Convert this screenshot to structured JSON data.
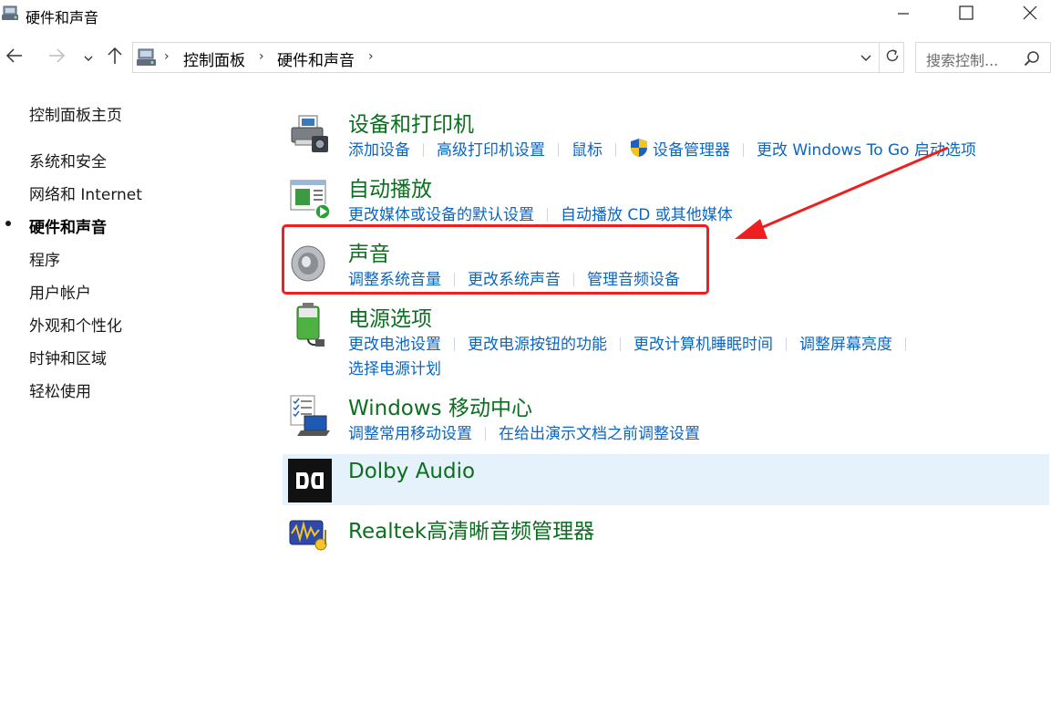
{
  "window": {
    "title": "硬件和声音",
    "icon": "control-panel-icon",
    "buttons": [
      "minimize-icon",
      "maximize-icon",
      "close-icon"
    ]
  },
  "navigation": {
    "back_icon": "arrow-left-icon",
    "forward_icon": "arrow-right-icon",
    "recent_icon": "chevron-down-icon",
    "up_icon": "arrow-up-icon",
    "breadcrumbs": [
      "控制面板",
      "硬件和声音"
    ],
    "search_placeholder": "搜索控制..."
  },
  "sidebar": {
    "home": "控制面板主页",
    "items": [
      {
        "label": "系统和安全",
        "current": false
      },
      {
        "label": "网络和 Internet",
        "current": false
      },
      {
        "label": "硬件和声音",
        "current": true
      },
      {
        "label": "程序",
        "current": false
      },
      {
        "label": "用户帐户",
        "current": false
      },
      {
        "label": "外观和个性化",
        "current": false
      },
      {
        "label": "时钟和区域",
        "current": false
      },
      {
        "label": "轻松使用",
        "current": false
      }
    ]
  },
  "categories": [
    {
      "title": "设备和打印机",
      "icon": "printer-icon",
      "links": [
        "添加设备",
        "高级打印机设置",
        "鼠标",
        "设备管理器",
        "更改 Windows To Go 启动选项"
      ]
    },
    {
      "title": "自动播放",
      "icon": "autoplay-icon",
      "links": [
        "更改媒体或设备的默认设置",
        "自动播放 CD 或其他媒体"
      ]
    },
    {
      "title": "声音",
      "icon": "speaker-icon",
      "links": [
        "调整系统音量",
        "更改系统声音",
        "管理音频设备"
      ]
    },
    {
      "title": "电源选项",
      "icon": "battery-power-icon",
      "links": [
        "更改电池设置",
        "更改电源按钮的功能",
        "更改计算机睡眠时间",
        "调整屏幕亮度",
        "选择电源计划"
      ]
    },
    {
      "title": "Windows 移动中心",
      "icon": "mobility-center-icon",
      "links": [
        "调整常用移动设置",
        "在给出演示文档之前调整设置"
      ]
    },
    {
      "title": "Dolby Audio",
      "icon": "dolby-icon",
      "links": []
    },
    {
      "title": "Realtek高清晰音频管理器",
      "icon": "realtek-audio-icon",
      "links": []
    }
  ],
  "colors": {
    "category_title": "#0c6e1f",
    "link": "#0a66c2",
    "highlight_row": "#e5f1fb",
    "annotation": "#ef1f1f"
  }
}
